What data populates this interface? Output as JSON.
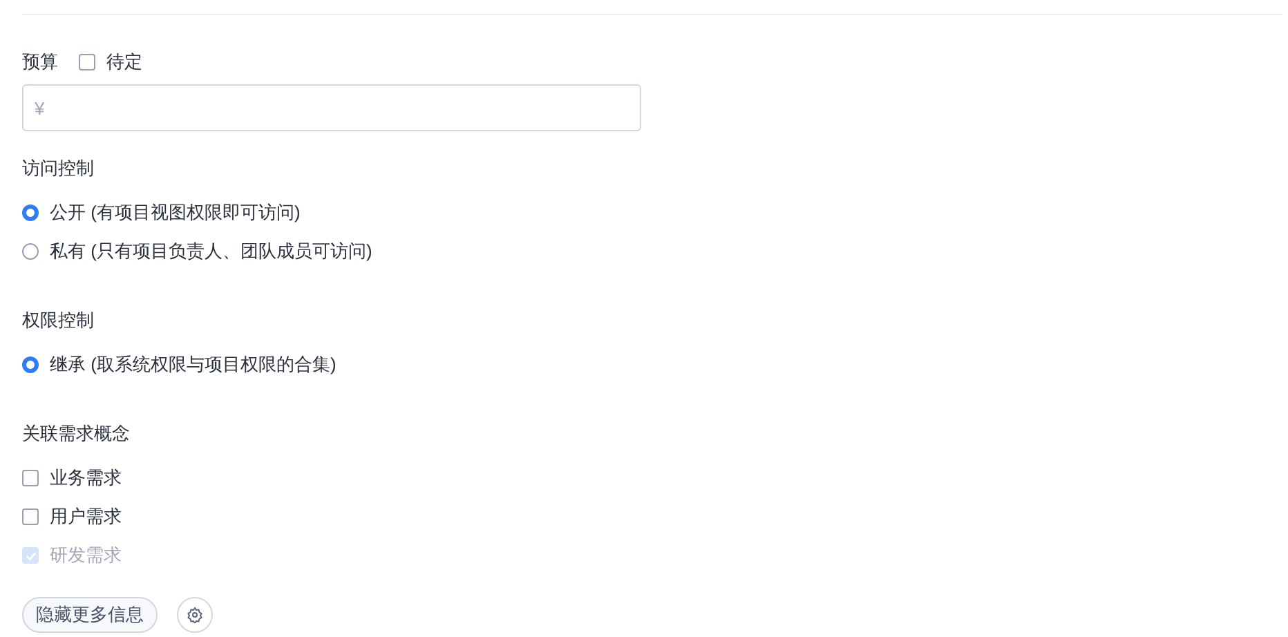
{
  "budget": {
    "label": "预算",
    "tbd": {
      "label": "待定",
      "checked": false
    },
    "input": {
      "placeholder": "¥"
    }
  },
  "access_control": {
    "label": "访问控制",
    "options": [
      {
        "label": "公开 (有项目视图权限即可访问)",
        "selected": true
      },
      {
        "label": "私有 (只有项目负责人、团队成员可访问)",
        "selected": false
      }
    ]
  },
  "permission_control": {
    "label": "权限控制",
    "options": [
      {
        "label": "继承 (取系统权限与项目权限的合集)",
        "selected": true
      }
    ]
  },
  "requirement_concepts": {
    "label": "关联需求概念",
    "items": [
      {
        "label": "业务需求",
        "checked": false,
        "disabled": false
      },
      {
        "label": "用户需求",
        "checked": false,
        "disabled": false
      },
      {
        "label": "研发需求",
        "checked": true,
        "disabled": true
      }
    ]
  },
  "actions": {
    "toggle_button": "隐藏更多信息"
  }
}
